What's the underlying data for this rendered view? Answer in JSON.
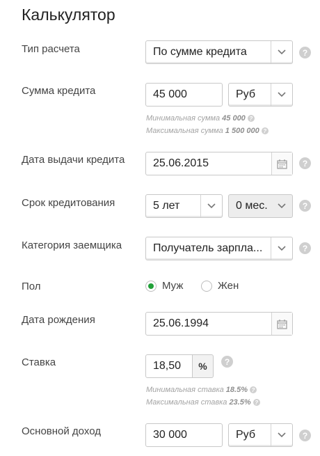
{
  "title": "Калькулятор",
  "calc_type": {
    "label": "Тип расчета",
    "value": "По сумме кредита"
  },
  "loan_amount": {
    "label": "Сумма кредита",
    "value": "45 000",
    "currency": "Руб",
    "min_text": "Минимальная сумма",
    "min_value": "45 000",
    "max_text": "Максимальная сумма",
    "max_value": "1 500 000"
  },
  "issue_date": {
    "label": "Дата выдачи кредита",
    "value": "25.06.2015"
  },
  "term": {
    "label": "Срок кредитования",
    "years": "5 лет",
    "months": "0 мес."
  },
  "borrower_category": {
    "label": "Категория заемщика",
    "value": "Получатель зарпла..."
  },
  "gender": {
    "label": "Пол",
    "male": "Муж",
    "female": "Жен",
    "selected": "male"
  },
  "birth_date": {
    "label": "Дата рождения",
    "value": "25.06.1994"
  },
  "rate": {
    "label": "Ставка",
    "value": "18,50",
    "unit": "%",
    "min_text": "Минимальная ставка",
    "min_value": "18.5%",
    "max_text": "Максимальная ставка",
    "max_value": "23.5%"
  },
  "income": {
    "label": "Основной доход",
    "value": "30 000",
    "currency": "Руб"
  },
  "help_glyph": "?",
  "colors": {
    "accent": "#21a038",
    "help": "#cfcfcf",
    "hint": "#a3a3a3"
  }
}
